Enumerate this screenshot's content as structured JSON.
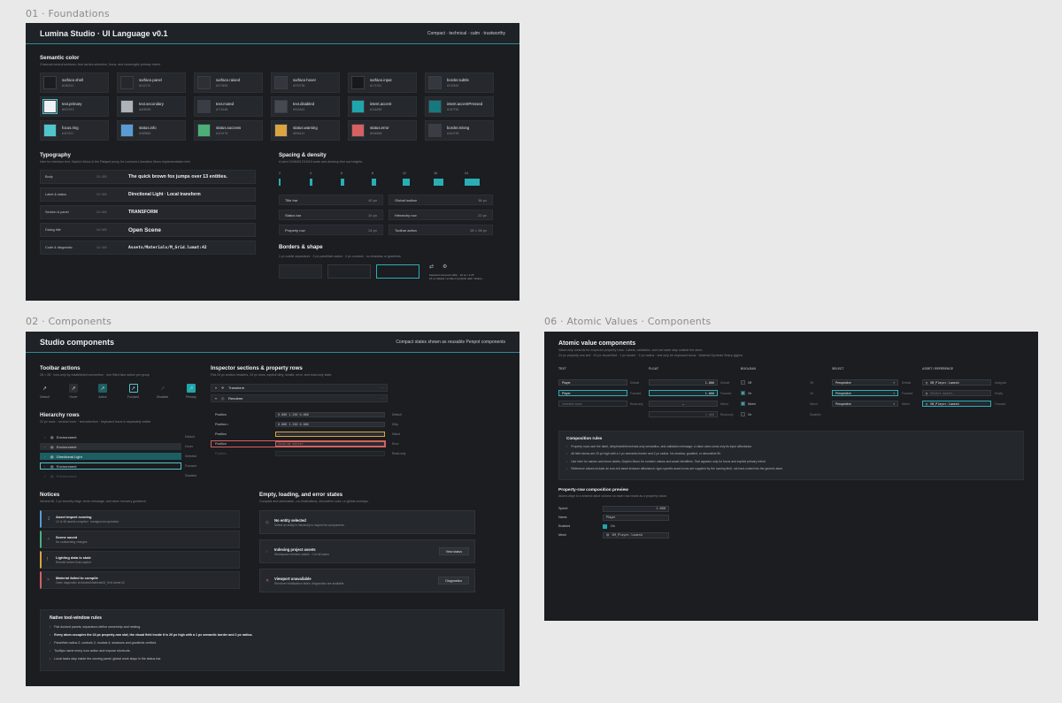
{
  "colors": {
    "canvas": "#e9e9e9",
    "frame": "#1b1d21",
    "accent": "#2aaeb5",
    "warning": "#d9a441",
    "error": "#d46060"
  },
  "labels": {
    "f1": "01 · Foundations",
    "f2": "02 · Components",
    "f3": "06 · Atomic Values · Components"
  },
  "foundations": {
    "title": "Lumina Studio · UI Language v0.1",
    "tagline": "Compact · technical · calm · trustworthy",
    "semantic": {
      "heading": "Semantic color",
      "desc": "Charcoal neutral surfaces; teal carries selection, focus, and meaningful primary intent.",
      "swatches": [
        {
          "name": "surface.shell",
          "hex": "#1B1D21",
          "color": "#1b1d21"
        },
        {
          "name": "surface.panel",
          "hex": "#24272C",
          "color": "#24272c"
        },
        {
          "name": "surface.raised",
          "hex": "#2C3035",
          "color": "#2c3035"
        },
        {
          "name": "surface.hover",
          "hex": "#33373D",
          "color": "#33373d"
        },
        {
          "name": "surface.input",
          "hex": "#17191C",
          "color": "#17191c"
        },
        {
          "name": "border.subtle",
          "hex": "#34383E",
          "color": "#34383e"
        },
        {
          "name": "text.primary",
          "hex": "#EEF0F3",
          "color": "#eef0f3"
        },
        {
          "name": "text.secondary",
          "hex": "#AEB3B9",
          "color": "#aeb3b9"
        },
        {
          "name": "text.muted",
          "hex": "#7C828A",
          "color": "#3a3e44"
        },
        {
          "name": "text.disabled",
          "hex": "#555A61",
          "color": "#454950"
        },
        {
          "name": "intent.accent",
          "hex": "#2AAEB5",
          "color": "#1fa6ad"
        },
        {
          "name": "intent.accentPressed",
          "hex": "#1B7F85",
          "color": "#17787e"
        },
        {
          "name": "focus.ring",
          "hex": "#4FC6CC",
          "color": "#4fc6cc"
        },
        {
          "name": "status.info",
          "hex": "#5B9BD5",
          "color": "#5b9bd5"
        },
        {
          "name": "status.success",
          "hex": "#4CAF78",
          "color": "#4caf78"
        },
        {
          "name": "status.warning",
          "hex": "#D9A441",
          "color": "#d9a441"
        },
        {
          "name": "status.error",
          "hex": "#D46060",
          "color": "#d46060"
        },
        {
          "name": "border.strong",
          "hex": "#4A4F56",
          "color": "#3a3e44"
        }
      ]
    },
    "typography": {
      "heading": "Typography",
      "desc": "Inter for interface text, DejaVu Mono & the Palapet proxy for Lumina's Liberation Mono implementation font.",
      "rows": [
        {
          "role": "Body",
          "size": "10 / 400",
          "sample": "The quick brown fox jumps over 13 entities."
        },
        {
          "role": "Label & status",
          "size": "10 / 500",
          "sample": "Directional Light · Local transform"
        },
        {
          "role": "Section & panel",
          "size": "10 / 600",
          "sample": "TRANSFORM"
        },
        {
          "role": "Dialog title",
          "size": "16 / 600",
          "sample": "Open Scene"
        },
        {
          "role": "Code & diagnostic",
          "size": "10 / 400",
          "sample": "Assets/Materials/M_Grid.lumat:42"
        }
      ]
    },
    "spacing": {
      "heading": "Spacing & density",
      "desc": "A strict 2/4/6/8/12/16/24 scale and desktop-first row heights.",
      "steps": [
        "2",
        "4",
        "6",
        "8",
        "12",
        "16",
        "24"
      ],
      "dims": [
        {
          "k": "Title bar",
          "v": "40 px"
        },
        {
          "k": "Global toolbar",
          "v": "36 px"
        },
        {
          "k": "Status bar",
          "v": "24 px"
        },
        {
          "k": "Hierarchy row",
          "v": "22 px"
        },
        {
          "k": "Property row",
          "v": "24 px"
        },
        {
          "k": "Toolbar action",
          "v": "28 × 28 px"
        }
      ]
    },
    "borders": {
      "heading": "Borders & shape",
      "desc": "1 px subtle separators · 2 px panel/tab radius · 2 px controls · no shadows or gradients",
      "note1": "Selected surround utility · 16 px / 1.25",
      "note2": "16 px default / emblem symbols disk / hollow…"
    }
  },
  "components": {
    "title": "Studio components",
    "tagline": "Compact states shown as reusable Penpot components",
    "toolbar": {
      "heading": "Toolbar actions",
      "desc": "28 × 28 · icon-only by established convention · one filled blue action per group",
      "states": [
        "Default",
        "Hover",
        "Active",
        "Focused",
        "Disabled",
        "Primary"
      ]
    },
    "inspector": {
      "heading": "Inspector sections & property rows",
      "desc": "Flat 24 px section headers, 24 px rows, explicit dirty, invalid, error, and read-only state.",
      "sections": [
        "Transform",
        "Renderer"
      ],
      "rows": [
        {
          "k": "Position",
          "v": "0.000   1.250   0.000",
          "s": "Default"
        },
        {
          "k": "Position •",
          "v": "0.000   1.250   0.000",
          "s": "Dirty"
        },
        {
          "k": "Position",
          "v": "—",
          "s": "Mixed"
        },
        {
          "k": "Position",
          "v": "Invalid vector",
          "s": "Error"
        },
        {
          "k": "Position",
          "v": "",
          "s": "Read-only"
        }
      ]
    },
    "hierarchy": {
      "heading": "Hierarchy rows",
      "desc": "22 px rows · neutral hover · teal selection · keyboard focus is separately visible",
      "rows": [
        {
          "label": "Environment",
          "state": "Default"
        },
        {
          "label": "Environment",
          "state": "Hover"
        },
        {
          "label": "Directional Light",
          "state": "Selected"
        },
        {
          "label": "Environment",
          "state": "Focused"
        },
        {
          "label": "Environment",
          "state": "Disabled"
        }
      ]
    },
    "notices": {
      "heading": "Notices",
      "desc": "Neutral fill, 2 px severity edge, terse message, and clear recovery guidance.",
      "items": [
        {
          "icon": "↧",
          "title": "Asset import running",
          "sub": "12 of 48 assets compiled · background operation",
          "color": "#5b9bd5"
        },
        {
          "icon": "✓",
          "title": "Scene saved",
          "sub": "No outstanding changes",
          "color": "#4caf78"
        },
        {
          "icon": "!",
          "title": "Lighting data is stale",
          "sub": "Rebuild before final capture",
          "color": "#d9a441"
        },
        {
          "icon": "×",
          "title": "Material failed to compile",
          "sub": "Open diagnostic at Assets/Materials/M_Grid.lumat:42",
          "color": "#d46060"
        }
      ]
    },
    "states": {
      "heading": "Empty, loading, and error states",
      "desc": "Compact and actionable—no illustrations, decorative color, or global overlays.",
      "items": [
        {
          "icon": "◇",
          "title": "No entity selected",
          "sub": "Select an entity in hierarchy to inspect its components.",
          "button": ""
        },
        {
          "icon": "◌",
          "title": "Indexing project assets",
          "sub": "Workspace remains usable · 0 of all scans",
          "button": "View status"
        },
        {
          "icon": "✕",
          "title": "Viewport unavailable",
          "sub": "Renderer initialization failed; diagnostics are available.",
          "button": "Diagnostics"
        }
      ]
    },
    "rules": {
      "heading": "Native tool-window rules",
      "items": [
        "Flat docked panels; separators define ownership and nesting.",
        "Every atom occupies the 24 px property-row slot; the visual field inside it is 20 px high with a 1 px semantic border and 2 px radius.",
        "Panel/tab radius 2; controls 2; modals 4; shadows and gradients omitted.",
        "Tooltips name every icon action and expose shortcuts.",
        "Local tasks stay inside the owning panel; global work stays in the status bar."
      ]
    }
  },
  "atomic": {
    "heading": "Atomic value components",
    "desc": "Value-only controls for inspector property rows. Labels, validation, and row state stay outside the atom.",
    "desc2": "24 px property row slot · 20 px visual field · 1 px border · 2 px radius · teal only for keyboard focus · Material Symbols Sharp glyphs",
    "columns": [
      "TEXT",
      "FLOAT",
      "BOOLEAN",
      "SELECT",
      "ASSET / REFERENCE"
    ],
    "text": [
      {
        "v": "Player",
        "s": "Default"
      },
      {
        "v": "Player",
        "s": "Focused"
      },
      {
        "v": "Inherited name",
        "s": "Read-only"
      }
    ],
    "float": [
      {
        "v": "1.000",
        "s": "Default"
      },
      {
        "v": "1.000",
        "s": "Focused"
      },
      {
        "v": "—",
        "s": "Mixed"
      },
      {
        "v": "1.000",
        "s": "Read-only"
      }
    ],
    "bool": [
      {
        "v": "Off",
        "s": "Off"
      },
      {
        "v": "On",
        "s": "On"
      },
      {
        "v": "Mixed",
        "s": "Mixed"
      },
      {
        "v": "On",
        "s": "Read-only"
      }
    ],
    "select": [
      {
        "v": "Perspective",
        "s": "Default"
      },
      {
        "v": "Perspective",
        "s": "Focused"
      },
      {
        "v": "Perspective",
        "s": "Mixed"
      },
      {
        "v": "",
        "s": "Disabled"
      }
    ],
    "selectStates": [
      "Off",
      "On",
      "Mixed",
      "Disabled"
    ],
    "asset": [
      {
        "v": "SM_Player.lumesh",
        "s": "Assigned"
      },
      {
        "v": "Select asset…",
        "s": "Empty"
      },
      {
        "v": "SM_Player.lumesh",
        "s": "Focused"
      }
    ],
    "assetStates": [
      "Default",
      "Empty",
      "Focused"
    ],
    "rules": {
      "heading": "Composition rules",
      "items": [
        "Property rows own the label, dirty/mixed/error/read-only semantics, and validation message; a value atom owns only its input affordance.",
        "All field atoms are 20 px high with a 1 px semantic border and 2 px radius. No shadow, gradient, or decorative fill.",
        "Use Inter for names and enum labels; DejaVu Mono for numeric values and asset identifiers. Teal appears only for focus and explicit primary intent.",
        "Reference values include an icon-led asset browser affordance; type-specific asset icons are supplied by the owning field, not hard-coded into the generic atom."
      ]
    },
    "preview": {
      "heading": "Property-row composition preview",
      "desc": "Atoms align to a shared value column so each row reads as a property value.",
      "rows": [
        {
          "k": "Speed",
          "v": "1.000"
        },
        {
          "k": "Name",
          "v": "Player"
        },
        {
          "k": "Enabled",
          "v": "On"
        },
        {
          "k": "Mesh",
          "v": "SM_Player.lumesh"
        }
      ]
    }
  }
}
